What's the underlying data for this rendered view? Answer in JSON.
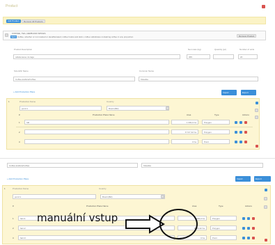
{
  "modal": {
    "title": "Product"
  },
  "toolbar": {
    "add_product": "Add Product",
    "remove_product": "Remove All Products"
  },
  "category": {
    "badge": "NEW",
    "name": "COFFEE, TEA, HERB AND SPICES",
    "description": "Coffee, whether or not roasted or decaffeinated; coffee husks and skins; coffee substitutes containing coffee in any proportion",
    "remove_label": "Remove Product"
  },
  "product": {
    "desc_label": "Product Description",
    "desc_value": "cafetiereuse za tage",
    "net_mass_label": "Net mass (kg)",
    "net_mass_value": "365",
    "quantity_label": "Quantity (pc)",
    "quantity_value": "",
    "number_label": "Number of units",
    "number_value": "20"
  },
  "names": {
    "scientific_label": "Scientific Name",
    "scientific_value": "Coffea arabica/Coffea",
    "common_label": "Common Name",
    "common_value": "Káva/ka"
  },
  "production": {
    "add_label": "Add Production Place",
    "import_label": "Import",
    "export_label": "Export"
  },
  "first_block": {
    "index": "1",
    "name_label": "Production Name",
    "name_value": "pozd 1",
    "country_label": "Country",
    "country_value": "Brazil (BR)",
    "col_hash": "#",
    "col_geom": "Production Place Name",
    "col_area": "Area",
    "col_type": "Type",
    "col_actions": "Actions",
    "rows": [
      {
        "idx": "1",
        "name": "fdd",
        "area": "1 000,0 ha",
        "type": "Polygon"
      },
      {
        "idx": "2",
        "name": "",
        "area": "8 727,32 ha",
        "type": "Polygon"
      },
      {
        "idx": "3",
        "name": "",
        "area": "0 ha",
        "type": "Point"
      }
    ]
  },
  "second_section": {
    "scientific_value": "Coffea arabica/Coffea",
    "common_value": "Káva/ka",
    "add_label": "Add Production Place",
    "import_label": "Import",
    "export_label": "Export",
    "index": "1",
    "name_label": "Production Name",
    "name_value": "pozd 1",
    "country_label": "Country",
    "country_value": "Brazil (BR)",
    "col_hash": "#",
    "col_geom": "Production Place Name",
    "col_area": "Area",
    "col_type": "Type",
    "col_actions": "Actions",
    "rows": [
      {
        "idx": "1",
        "name": "farm1",
        "area": "1000,0 ha",
        "type": "Polygon"
      },
      {
        "idx": "2",
        "name": "farm2",
        "area": "8725,32 ha",
        "type": "Polygon"
      },
      {
        "idx": "3",
        "name": "farm3",
        "area": "0 ha",
        "type": "Point"
      }
    ]
  },
  "annotation": {
    "text": "manuální vstup"
  }
}
